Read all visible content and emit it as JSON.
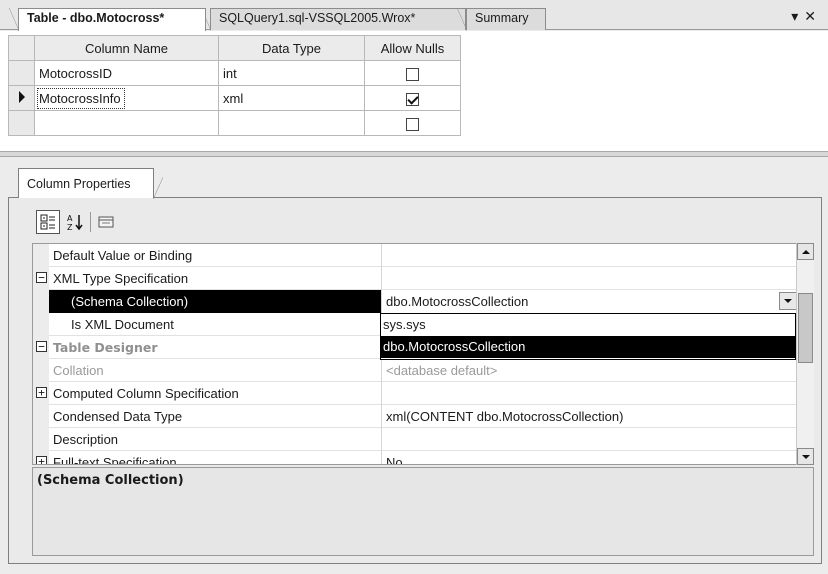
{
  "tabs": [
    {
      "label": "Table - dbo.Motocross*",
      "active": true
    },
    {
      "label": "SQLQuery1.sql-VSSQL2005.Wrox*",
      "active": false
    },
    {
      "label": "Summary",
      "active": false
    }
  ],
  "window_controls": {
    "pin": "▾",
    "close": "✕"
  },
  "grid": {
    "headers": [
      "Column Name",
      "Data Type",
      "Allow Nulls"
    ],
    "rows": [
      {
        "name": "MotocrossID",
        "type": "int",
        "allow_nulls": false
      },
      {
        "name": "MotocrossInfo",
        "type": "xml",
        "allow_nulls": true
      },
      {
        "name": "",
        "type": "",
        "allow_nulls": false
      }
    ]
  },
  "properties_panel": {
    "tab_label": "Column Properties",
    "toolbar": {
      "categorized_icon": "categorized-icon",
      "alphabetical_icon": "sort-az-icon",
      "pages_icon": "property-pages-icon"
    },
    "rows": [
      {
        "name": "Default Value or Binding",
        "value": ""
      },
      {
        "name": "XML Type Specification",
        "value": "",
        "expander": "⊟"
      },
      {
        "name": "(Schema Collection)",
        "value": "dbo.MotocrossCollection"
      },
      {
        "name": "Is XML Document",
        "value": ""
      },
      {
        "name": "Table Designer",
        "value": "",
        "expander": "⊟"
      },
      {
        "name": "Collation",
        "value": "<database default>"
      },
      {
        "name": "Computed Column Specification",
        "value": "",
        "expander": "⊞"
      },
      {
        "name": "Condensed Data Type",
        "value": "xml(CONTENT dbo.MotocrossCollection)"
      },
      {
        "name": "Description",
        "value": ""
      },
      {
        "name": "Full-text Specification",
        "value": "No",
        "expander": "⊞"
      }
    ],
    "dropdown_options": [
      "sys.sys",
      "dbo.MotocrossCollection"
    ],
    "description_title": "(Schema Collection)"
  }
}
